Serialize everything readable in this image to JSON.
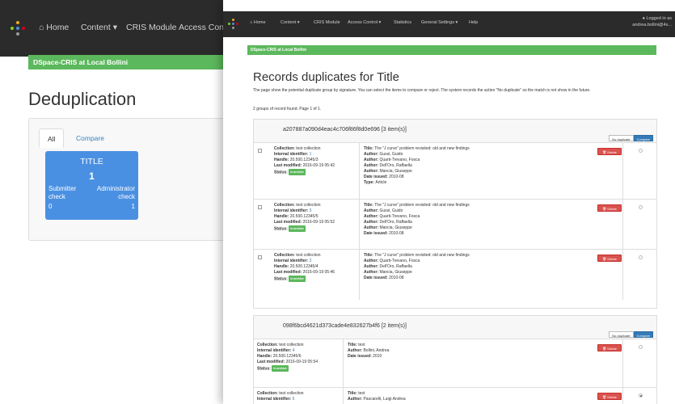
{
  "background": {
    "nav": {
      "home": "Home",
      "content": "Content ▾",
      "cris": "CRIS Module",
      "access": "Access Control"
    },
    "banner": "DSpace-CRIS at Local Bollini",
    "title": "Deduplication",
    "tabs": {
      "all": "All",
      "compare": "Compare"
    },
    "tile": {
      "title": "TITLE",
      "count": "1",
      "left_label1": "Submitter",
      "left_label2": "check",
      "right_label1": "Administrator",
      "right_label2": "check",
      "left_value": "0",
      "right_value": "1"
    }
  },
  "foreground": {
    "nav": {
      "home": "Home",
      "content": "Content ▾",
      "cris": "CRIS Module",
      "access": "Access Control ▾",
      "statistics": "Statistics",
      "general": "General Settings ▾",
      "help": "Help"
    },
    "user": {
      "line1": "Logged in as",
      "line2": "andrea.bollini@4s..."
    },
    "banner": "DSpace-CRIS at Local Bollini",
    "title": "Records duplicates for Title",
    "intro": "The page show the potential duplicate group by signature. You can select the items to compare or reject. The system records the action \"No duplicate\" so the match is not show in the future.",
    "found": "2 groups of record found. Page 1 of 1.",
    "groups": [
      {
        "title": "a207887a090d4eac4c706f86f8d0e696 [3 item(s)]",
        "no_dup": "No duplicate",
        "compare": "Compare",
        "rows": [
          {
            "collection": "test collection",
            "internal_id": "1",
            "handle": "20.500.12345/3",
            "modified": "2016-09-19 05:42",
            "status": "In archive",
            "title": "The \"J curve\" problem revisited: old and new findings",
            "authors": [
              "Gussi, Guido",
              "Quarti-Trevano, Fosca",
              "Dell'Oro, Raffaella",
              "Mancia, Giuseppe"
            ],
            "date": "2010-08",
            "type": "Article"
          },
          {
            "collection": "test collection",
            "internal_id": "3",
            "handle": "20.500.12345/5",
            "modified": "2016-09-19 05:52",
            "status": "In archive",
            "title": "The \"J curve\" problem revisited: old and new findings",
            "authors": [
              "Gussi, Guido",
              "Quarti-Trevano, Fosca",
              "Dell'Oro, Raffaella",
              "Mancia, Giuseppe"
            ],
            "date": "2010-08"
          },
          {
            "collection": "test collection",
            "internal_id": "2",
            "handle": "20.500.12345/4",
            "modified": "2016-09-19 05:46",
            "status": "In archive",
            "title": "The \"J curve\" problem revisited: old and new findings",
            "authors": [
              "Quarti-Trevano, Fosca",
              "Dell'Oro, Raffaella",
              "Mancia, Giuseppe"
            ],
            "date": "2010-08"
          }
        ]
      },
      {
        "title": "098f6bcd4621d373cade4e832627b4f6 [2 item(s)]",
        "no_dup": "No duplicate",
        "compare": "Compare",
        "rows": [
          {
            "collection": "test collection",
            "internal_id": "4",
            "handle": "20.500.12345/6",
            "modified": "2016-09-19 05:54",
            "status": "In archive",
            "title": "test",
            "authors": [
              "Bollini, Andrea"
            ],
            "date": "2010"
          },
          {
            "collection": "test collection",
            "internal_id": "5",
            "title": "test",
            "authors": [
              "Pascarelli, Luigi Andrea"
            ]
          }
        ]
      }
    ],
    "labels": {
      "collection": "Collection:",
      "internal_id": "Internal identifier:",
      "handle": "Handle:",
      "modified": "Last modified:",
      "status": "Status:",
      "title": "Title:",
      "author": "Author:",
      "date": "Date issued:",
      "type": "Type:",
      "delete": "Delete"
    }
  },
  "colors": {
    "navbar": "#2b2b2b",
    "banner": "#5cb85c",
    "tile": "#4a90e2",
    "delete": "#d9534f",
    "compare": "#337ab7"
  }
}
